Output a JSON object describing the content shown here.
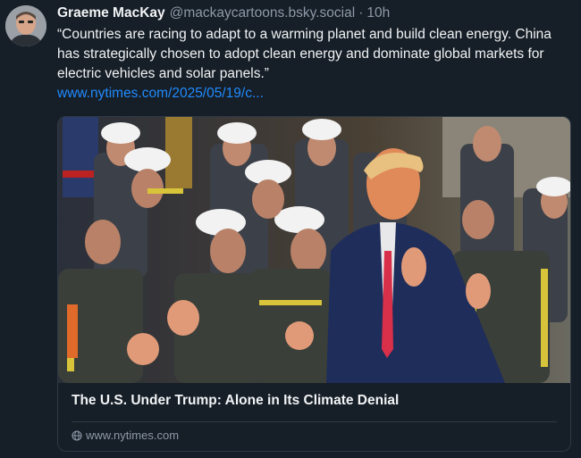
{
  "post": {
    "author_name": "Graeme MacKay",
    "author_handle": "@mackaycartoons.bsky.social",
    "separator": "·",
    "time": "10h",
    "text": "“Countries are racing to adapt to a warming planet and build clean energy. China has strategically chosen to adopt clean energy and dominate global markets for electric vehicles and solar panels.”",
    "link": "www.nytimes.com/2025/05/19/c..."
  },
  "card": {
    "title": "The U.S. Under Trump: Alone in Its Climate Denial",
    "domain": "www.nytimes.com",
    "image_icon": "news-photo",
    "globe_icon": "globe-icon"
  },
  "colors": {
    "background": "#161e27",
    "text": "#f1f3f5",
    "muted": "#8d9aa8",
    "link": "#208bfe",
    "border": "#2e3a47"
  }
}
